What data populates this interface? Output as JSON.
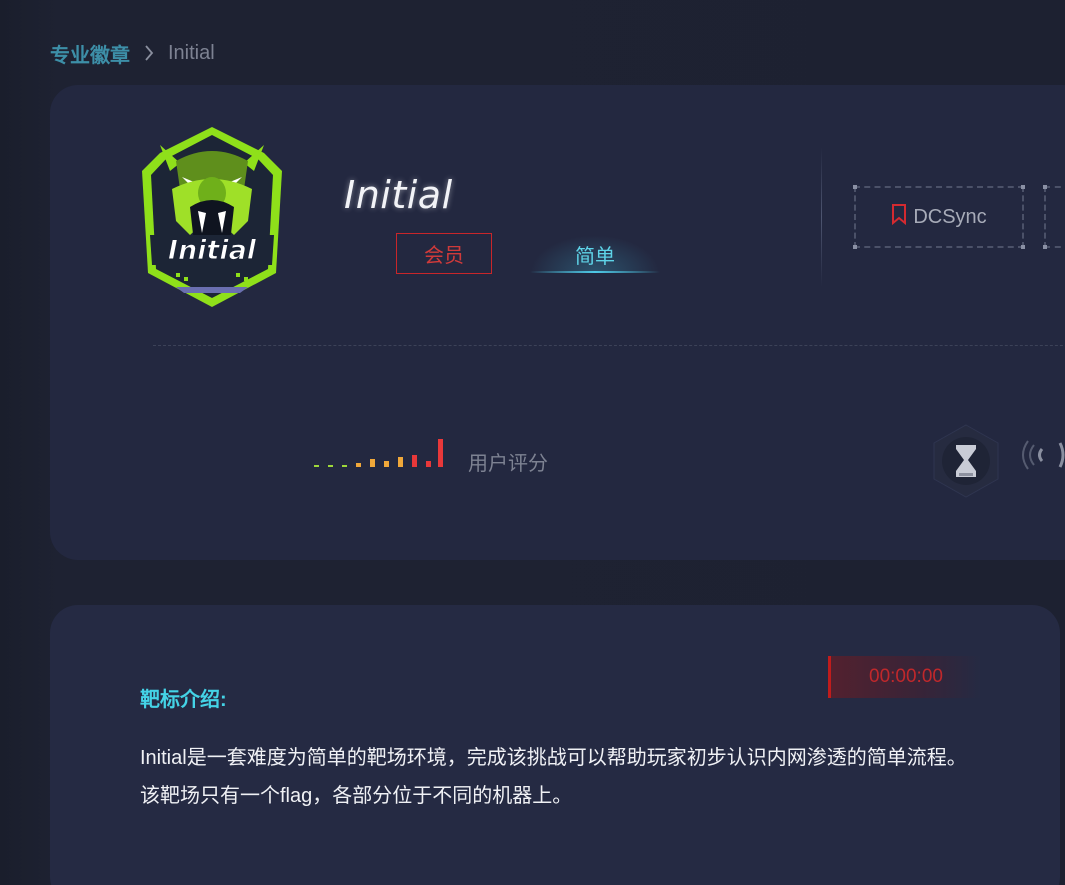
{
  "breadcrumb": {
    "parent": "专业徽章",
    "current": "Initial"
  },
  "lab": {
    "title": "Initial",
    "badge_text": "Initial",
    "tags": {
      "member": "会员",
      "level": "简单"
    },
    "skills": [
      "DCSync"
    ]
  },
  "rating": {
    "label": "用户评分"
  },
  "intro": {
    "heading": "靶标介绍:",
    "timer": "00:00:00",
    "description": "Initial是一套难度为简单的靶场环境，完成该挑战可以帮助玩家初步认识内网渗透的简单流程。该靶场只有一个flag，各部分位于不同的机器上。"
  },
  "colors": {
    "accent_cyan": "#44d3e6",
    "danger_red": "#c8262a",
    "badge_green": "#8fe01a",
    "card_bg": "#232840"
  }
}
